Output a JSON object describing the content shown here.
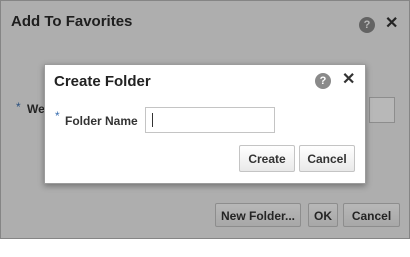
{
  "outer_dialog": {
    "title": "Add To Favorites",
    "help_icon_text": "?",
    "close_icon_text": "✕",
    "field_label_visible": "We",
    "required_marker": "*",
    "buttons": {
      "new_folder": "New Folder...",
      "ok": "OK",
      "cancel": "Cancel"
    }
  },
  "inner_dialog": {
    "title": "Create Folder",
    "help_icon_text": "?",
    "close_icon_text": "✕",
    "required_marker": "*",
    "folder_name_label": "Folder Name",
    "folder_name_value": "",
    "buttons": {
      "create": "Create",
      "cancel": "Cancel"
    }
  }
}
